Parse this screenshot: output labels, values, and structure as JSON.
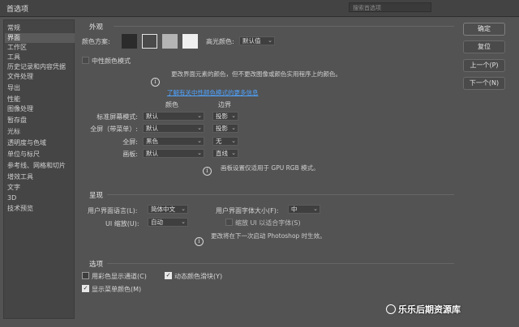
{
  "window": {
    "title": "首选项",
    "search_placeholder": "搜索首选项"
  },
  "sidebar": {
    "items": [
      "常规",
      "界面",
      "工作区",
      "工具",
      "历史记录和内容凭据",
      "文件处理",
      "导出",
      "性能",
      "图像处理",
      "暂存盘",
      "光标",
      "透明度与色域",
      "单位与标尺",
      "参考线、网格和切片",
      "增效工具",
      "文字",
      "3D",
      "技术预览"
    ],
    "active_index": 1
  },
  "buttons": {
    "ok": "确定",
    "reset": "复位",
    "prev": "上一个(P)",
    "next": "下一个(N)"
  },
  "appearance": {
    "title": "外观",
    "color_theme_label": "颜色方案:",
    "swatches": [
      "#2b2b2b",
      "#4a4a4a",
      "#b4b4b4",
      "#efefef"
    ],
    "selected_swatch": 1,
    "highlight_label": "高光颜色:",
    "highlight_value": "默认值",
    "neutral_label": "中性颜色模式",
    "neutral_hint": "更改界面元素的颜色，但不更改图像或颜色实用程序上的颜色。",
    "learn_more": "了解有关中性颜色模式的更多信息",
    "col_color": "颜色",
    "col_border": "边界",
    "rows": [
      {
        "label": "标准屏幕模式:",
        "color": "默认",
        "border": "投影"
      },
      {
        "label": "全屏（带菜单）:",
        "color": "默认",
        "border": "投影"
      },
      {
        "label": "全屏:",
        "color": "黑色",
        "border": "无"
      },
      {
        "label": "画板:",
        "color": "默认",
        "border": "直线"
      }
    ],
    "gpu_hint": "画板设置仅适用于 GPU RGB 模式。"
  },
  "presentation": {
    "title": "呈现",
    "ui_lang_label": "用户界面语言(L):",
    "ui_lang_value": "简体中文",
    "ui_font_label": "用户界面字体大小(F):",
    "ui_font_value": "中",
    "ui_scale_label": "UI 缩放(U):",
    "ui_scale_value": "自动",
    "scale_font_label": "缩放 UI 以适合字体(S)",
    "restart_hint": "更改将在下一次启动 Photoshop 时生效。"
  },
  "options": {
    "title": "选项",
    "channels_color": {
      "label": "用彩色显示通道(C)",
      "checked": false
    },
    "dynamic_sliders": {
      "label": "动态颜色滑块(Y)",
      "checked": true
    },
    "menu_colors": {
      "label": "显示菜单颜色(M)",
      "checked": true
    }
  },
  "watermark": "乐乐后期资源库"
}
